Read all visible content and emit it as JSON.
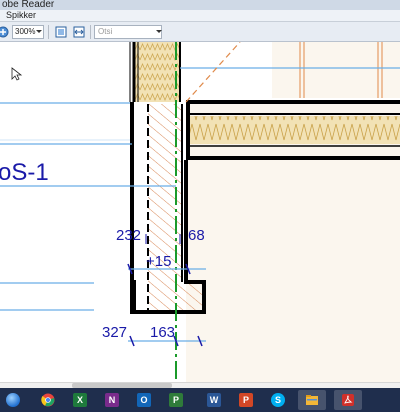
{
  "window": {
    "title": "obe Reader"
  },
  "menu": {
    "items": [
      "Spikker"
    ]
  },
  "toolbar": {
    "zoom_value": "300%",
    "find_placeholder": "Otsi"
  },
  "drawing": {
    "label_section": "oS-1",
    "dim_left_upper": "232",
    "dim_right_upper": "68",
    "dim_level": "+15",
    "dim_bottom_left": "327",
    "dim_bottom_mid": "163"
  },
  "colors": {
    "dimension_text": "#1a1aa8",
    "reference_line": "#6aaee6",
    "axis_line": "#1a9a2a",
    "cut_line": "#e08a4a",
    "insulation": "#f2e2b5",
    "hatch": "#d98a5a",
    "taskbar": "#1f2e4d"
  },
  "taskbar": {
    "apps": [
      {
        "name": "chrome-icon",
        "color": "#e8453c"
      },
      {
        "name": "excel-icon",
        "color": "#1e7a3c",
        "letter": "X"
      },
      {
        "name": "onenote-icon",
        "color": "#7a2b8c",
        "letter": "N"
      },
      {
        "name": "outlook-icon",
        "color": "#1266b8",
        "letter": "O"
      },
      {
        "name": "project-icon",
        "color": "#2f7b3a",
        "letter": "P"
      },
      {
        "name": "word-icon",
        "color": "#2b5797",
        "letter": "W"
      },
      {
        "name": "powerpoint-icon",
        "color": "#d24726",
        "letter": "P"
      },
      {
        "name": "skype-icon",
        "color": "#00aff0",
        "letter": "S"
      },
      {
        "name": "explorer-icon",
        "color": "#f3b737"
      },
      {
        "name": "acrobat-icon",
        "color": "#d0302a"
      }
    ]
  }
}
